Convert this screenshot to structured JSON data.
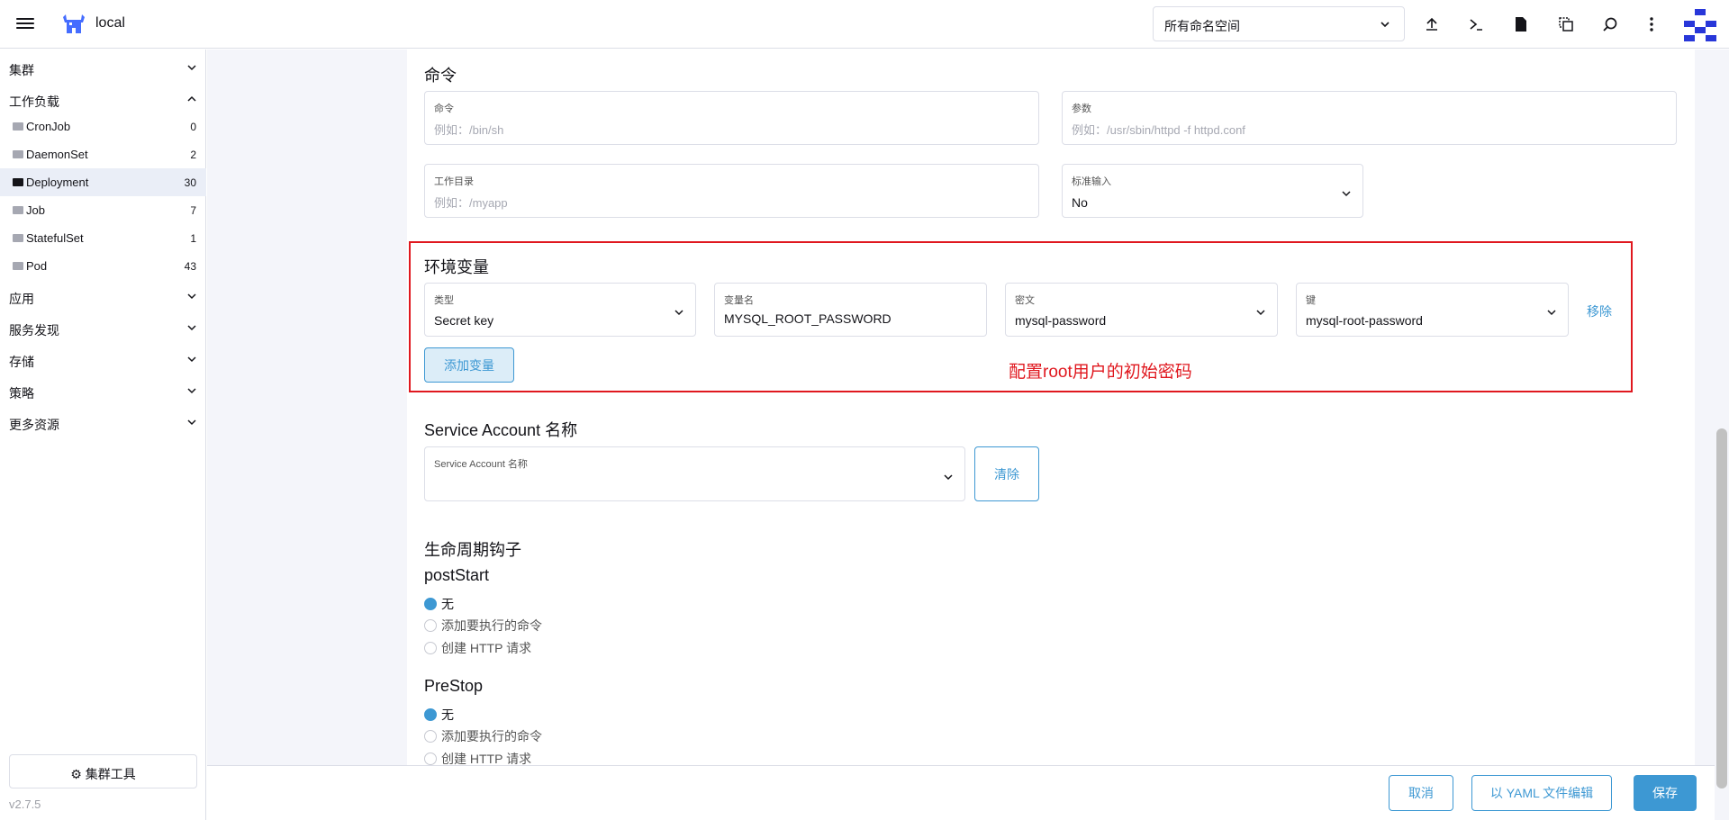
{
  "header": {
    "cluster_name": "local",
    "namespace_select": "所有命名空间"
  },
  "sidebar": {
    "groups": [
      {
        "label": "集群",
        "expanded": false
      },
      {
        "label": "工作负载",
        "expanded": true
      },
      {
        "label": "应用",
        "expanded": false
      },
      {
        "label": "服务发现",
        "expanded": false
      },
      {
        "label": "存储",
        "expanded": false
      },
      {
        "label": "策略",
        "expanded": false
      },
      {
        "label": "更多资源",
        "expanded": false
      }
    ],
    "workload_items": [
      {
        "label": "CronJob",
        "count": "0"
      },
      {
        "label": "DaemonSet",
        "count": "2"
      },
      {
        "label": "Deployment",
        "count": "30"
      },
      {
        "label": "Job",
        "count": "7"
      },
      {
        "label": "StatefulSet",
        "count": "1"
      },
      {
        "label": "Pod",
        "count": "43"
      }
    ],
    "cluster_tools": "集群工具",
    "version": "v2.7.5"
  },
  "command": {
    "title": "命令",
    "command_label": "命令",
    "command_placeholder": "例如：/bin/sh",
    "args_label": "参数",
    "args_placeholder": "例如：/usr/sbin/httpd -f httpd.conf",
    "workdir_label": "工作目录",
    "workdir_placeholder": "例如：/myapp",
    "stdin_label": "标准输入",
    "stdin_value": "No"
  },
  "env": {
    "title": "环境变量",
    "type_label": "类型",
    "type_value": "Secret key",
    "name_label": "变量名",
    "name_value": "MYSQL_ROOT_PASSWORD",
    "secret_label": "密文",
    "secret_value": "mysql-password",
    "key_label": "键",
    "key_value": "mysql-root-password",
    "remove": "移除",
    "add": "添加变量",
    "annotation": "配置root用户的初始密码"
  },
  "service_account": {
    "title": "Service Account 名称",
    "label": "Service Account 名称",
    "clear": "清除"
  },
  "lifecycle": {
    "title": "生命周期钩子",
    "post_start": {
      "title": "postStart",
      "options": [
        "无",
        "添加要执行的命令",
        "创建 HTTP 请求"
      ],
      "selected": "无"
    },
    "pre_stop": {
      "title": "PreStop",
      "options": [
        "无",
        "添加要执行的命令",
        "创建 HTTP 请求"
      ],
      "selected": "无"
    }
  },
  "footer": {
    "cancel": "取消",
    "edit_yaml": "以 YAML 文件编辑",
    "save": "保存"
  },
  "colors": {
    "accent": "#3d98d3",
    "highlight_border": "#e0181f",
    "annotation": "#e0181f"
  }
}
